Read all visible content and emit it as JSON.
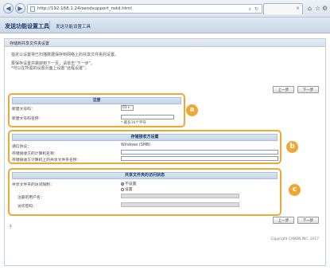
{
  "browser": {
    "url": "http://192.168.1.24/sendsupport_nstd.html",
    "back_glyph": "◀",
    "forward_glyph": "▶"
  },
  "app": {
    "title": "发送功能设置工具",
    "nav_link": "发送功能设置工具"
  },
  "page": {
    "section_title": "存储到共享文件夹设置",
    "intro_lines": [
      "指定以设置将已扫描数据保存到网络上的共享文件夹的设置。",
      "要保存设置并跳转到下一页，请单击“下一步”。",
      "*可以在所需的设置页面上设置“远程设置”。"
    ],
    "prev_label": "上一步",
    "next_label": "下一步",
    "copyright": "Copyright CANON INC. 2017"
  },
  "group_a": {
    "title": "注册",
    "callout": "a",
    "fields": [
      {
        "label": "新建文号码：",
        "value": "01"
      },
      {
        "label": "新建文号码名称：",
        "value": ""
      }
    ],
    "hint": "* 最多16个字符"
  },
  "group_b": {
    "title": "存储接收方设置",
    "callout": "b",
    "fields": [
      {
        "label": "通信协议：",
        "value": "Windows (SMB)"
      },
      {
        "label": "存储接收方的计算机名称：",
        "value": ""
      },
      {
        "label": "存储接收方计算机上的共享文件夹名称：",
        "value": ""
      }
    ]
  },
  "group_c": {
    "title": "共享文件夹的访问状态",
    "callout": "c",
    "access_label": "共享文件夹的访问限制：",
    "options": [
      {
        "label": "不设置",
        "selected": true
      },
      {
        "label": "设置",
        "selected": false
      }
    ],
    "user_label": "注册的用户名：",
    "password_label": "访问密码："
  },
  "colors": {
    "accent": "#f0a733",
    "header_blue": "#1f3d6b"
  }
}
